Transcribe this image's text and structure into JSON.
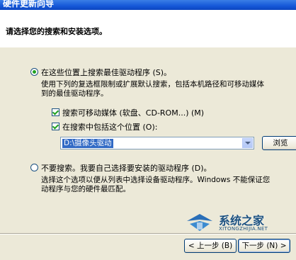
{
  "window": {
    "title": "硬件更新向导"
  },
  "header": {
    "instruction": "请选择您的搜索和安装选项。"
  },
  "option_search": {
    "label": "在这些位置上搜索最佳驱动程序 (S)。",
    "selected": true,
    "description_line1": "使用下列的复选框限制或扩展默认搜索，包括本机路径和可移动媒体",
    "description_line2": "到的最佳驱动程序。",
    "removable_media": {
      "label": "搜索可移动媒体 (软盘、CD-ROM...) (M)",
      "checked": true
    },
    "include_location": {
      "label": "在搜索中包括这个位置 (O):",
      "checked": true
    },
    "path": {
      "value": "D:\\摄像头驱动"
    },
    "browse_label": "浏览"
  },
  "option_manual": {
    "label": "不要搜索。我要自己选择要安装的驱动程序 (D)。",
    "selected": false,
    "description_line1": "选择这个选项以便从列表中选择设备驱动程序。Windows 不能保证您",
    "description_line2": "动程序与您的硬件最匹配。"
  },
  "buttons": {
    "back_label": "< 上一步 (B)",
    "next_label": "下一步 (N) >"
  },
  "watermark": {
    "brand": "系统之家",
    "url": "XITONGZHIJIA.NET"
  }
}
